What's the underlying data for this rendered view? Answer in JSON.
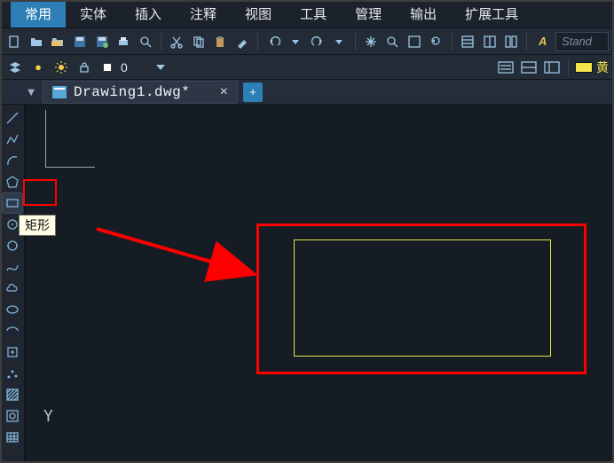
{
  "ribbon": {
    "tabs": [
      "常用",
      "实体",
      "插入",
      "注释",
      "视图",
      "工具",
      "管理",
      "输出",
      "扩展工具"
    ],
    "active_index": 0
  },
  "toolbar1": {
    "annotation_style_placeholder": "Stand"
  },
  "toolbar2": {
    "layer_dropdown_value": "0",
    "color_label": "黄"
  },
  "document": {
    "filename": "Drawing1.dwg*"
  },
  "left_tools": {
    "items": [
      {
        "name": "line-tool",
        "icon": "line"
      },
      {
        "name": "polyline-tool",
        "icon": "polyline"
      },
      {
        "name": "arc-tool",
        "icon": "arc"
      },
      {
        "name": "polygon-tool",
        "icon": "polygon"
      },
      {
        "name": "rectangle-tool",
        "icon": "rect",
        "selected": true,
        "tooltip": "矩形"
      },
      {
        "name": "circle-center-tool",
        "icon": "circle-c"
      },
      {
        "name": "circle-2pt-tool",
        "icon": "circle-2"
      },
      {
        "name": "spline-tool",
        "icon": "spline"
      },
      {
        "name": "revcloud-tool",
        "icon": "cloud"
      },
      {
        "name": "ellipse-tool",
        "icon": "ellipse"
      },
      {
        "name": "ellipse-arc-tool",
        "icon": "ellipse-arc"
      },
      {
        "name": "block-insert-tool",
        "icon": "block"
      },
      {
        "name": "point-tool",
        "icon": "point"
      },
      {
        "name": "hatch-tool",
        "icon": "hatch"
      },
      {
        "name": "region-tool",
        "icon": "region"
      },
      {
        "name": "table-tool",
        "icon": "table"
      }
    ]
  },
  "ucs": {
    "y_label": "Y"
  },
  "annotation": {
    "tooltip_text": "矩形"
  },
  "colors": {
    "accent": "#2f7fb7",
    "highlight": "#ff0000",
    "yellow": "#e4e446"
  }
}
